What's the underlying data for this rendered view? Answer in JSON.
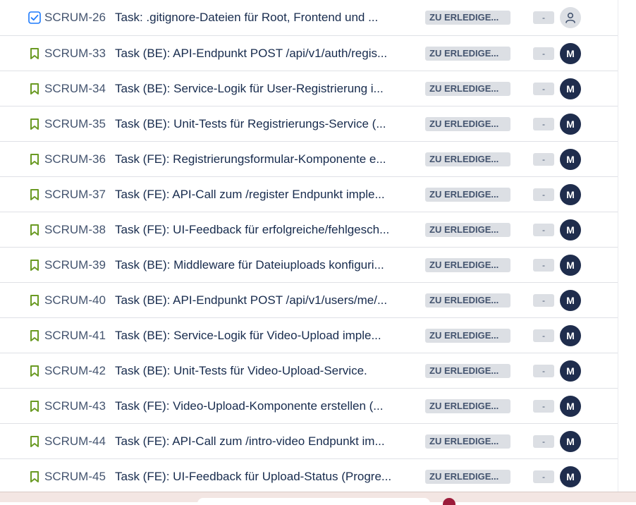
{
  "issues": [
    {
      "type": "task",
      "key": "SCRUM-26",
      "summary": "Task: .gitignore-Dateien für Root, Frontend und ...",
      "status": "ZU ERLEDIGE...",
      "estimate": "-",
      "assignee": ""
    },
    {
      "type": "story",
      "key": "SCRUM-33",
      "summary": "Task (BE): API-Endpunkt POST /api/v1/auth/regis...",
      "status": "ZU ERLEDIGE...",
      "estimate": "-",
      "assignee": "M"
    },
    {
      "type": "story",
      "key": "SCRUM-34",
      "summary": "Task (BE): Service-Logik für User-Registrierung i...",
      "status": "ZU ERLEDIGE...",
      "estimate": "-",
      "assignee": "M"
    },
    {
      "type": "story",
      "key": "SCRUM-35",
      "summary": "Task (BE): Unit-Tests für Registrierungs-Service (...",
      "status": "ZU ERLEDIGE...",
      "estimate": "-",
      "assignee": "M"
    },
    {
      "type": "story",
      "key": "SCRUM-36",
      "summary": "Task (FE): Registrierungsformular-Komponente e...",
      "status": "ZU ERLEDIGE...",
      "estimate": "-",
      "assignee": "M"
    },
    {
      "type": "story",
      "key": "SCRUM-37",
      "summary": "Task (FE): API-Call zum /register Endpunkt imple...",
      "status": "ZU ERLEDIGE...",
      "estimate": "-",
      "assignee": "M"
    },
    {
      "type": "story",
      "key": "SCRUM-38",
      "summary": "Task (FE): UI-Feedback für erfolgreiche/fehlgesch...",
      "status": "ZU ERLEDIGE...",
      "estimate": "-",
      "assignee": "M"
    },
    {
      "type": "story",
      "key": "SCRUM-39",
      "summary": "Task (BE): Middleware für Dateiuploads konfiguri...",
      "status": "ZU ERLEDIGE...",
      "estimate": "-",
      "assignee": "M"
    },
    {
      "type": "story",
      "key": "SCRUM-40",
      "summary": "Task (BE): API-Endpunkt POST /api/v1/users/me/...",
      "status": "ZU ERLEDIGE...",
      "estimate": "-",
      "assignee": "M"
    },
    {
      "type": "story",
      "key": "SCRUM-41",
      "summary": "Task (BE): Service-Logik für Video-Upload imple...",
      "status": "ZU ERLEDIGE...",
      "estimate": "-",
      "assignee": "M"
    },
    {
      "type": "story",
      "key": "SCRUM-42",
      "summary": "Task (BE): Unit-Tests für Video-Upload-Service.",
      "status": "ZU ERLEDIGE...",
      "estimate": "-",
      "assignee": "M"
    },
    {
      "type": "story",
      "key": "SCRUM-43",
      "summary": "Task (FE): Video-Upload-Komponente erstellen (...",
      "status": "ZU ERLEDIGE...",
      "estimate": "-",
      "assignee": "M"
    },
    {
      "type": "story",
      "key": "SCRUM-44",
      "summary": "Task (FE): API-Call zum /intro-video Endpunkt im...",
      "status": "ZU ERLEDIGE...",
      "estimate": "-",
      "assignee": "M"
    },
    {
      "type": "story",
      "key": "SCRUM-45",
      "summary": "Task (FE): UI-Feedback für Upload-Status (Progre...",
      "status": "ZU ERLEDIGE...",
      "estimate": "-",
      "assignee": "M"
    }
  ],
  "colors": {
    "task_icon": "#1d7afc",
    "story_icon": "#6a9a23",
    "status_bg": "#dcdfe4",
    "avatar_bg": "#1f2d4d"
  }
}
